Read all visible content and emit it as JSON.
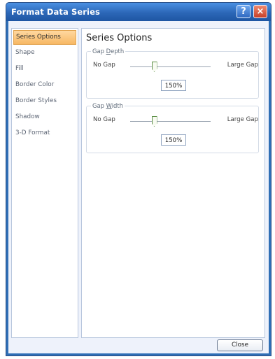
{
  "window": {
    "title": "Format Data Series",
    "help_label": "?",
    "close_label": "×"
  },
  "nav": {
    "items": [
      {
        "label": "Series Options",
        "active": true
      },
      {
        "label": "Shape"
      },
      {
        "label": "Fill"
      },
      {
        "label": "Border Color"
      },
      {
        "label": "Border Styles"
      },
      {
        "label": "Shadow"
      },
      {
        "label": "3-D Format"
      }
    ]
  },
  "panel": {
    "title": "Series Options",
    "gap_depth": {
      "legend_prefix": "Gap ",
      "legend_underlined": "D",
      "legend_suffix": "epth",
      "left_label": "No Gap",
      "right_label": "Large Gap",
      "value": "150%",
      "slider_fraction": 0.3
    },
    "gap_width": {
      "legend_prefix": "Gap ",
      "legend_underlined": "W",
      "legend_suffix": "idth",
      "left_label": "No Gap",
      "right_label": "Large Gap",
      "value": "150%",
      "slider_fraction": 0.3
    }
  },
  "footer": {
    "close_label": "Close"
  },
  "colors": {
    "title_bar": "#2c67b7",
    "active_nav": "#f7b864",
    "slider": "#5c8f46"
  }
}
